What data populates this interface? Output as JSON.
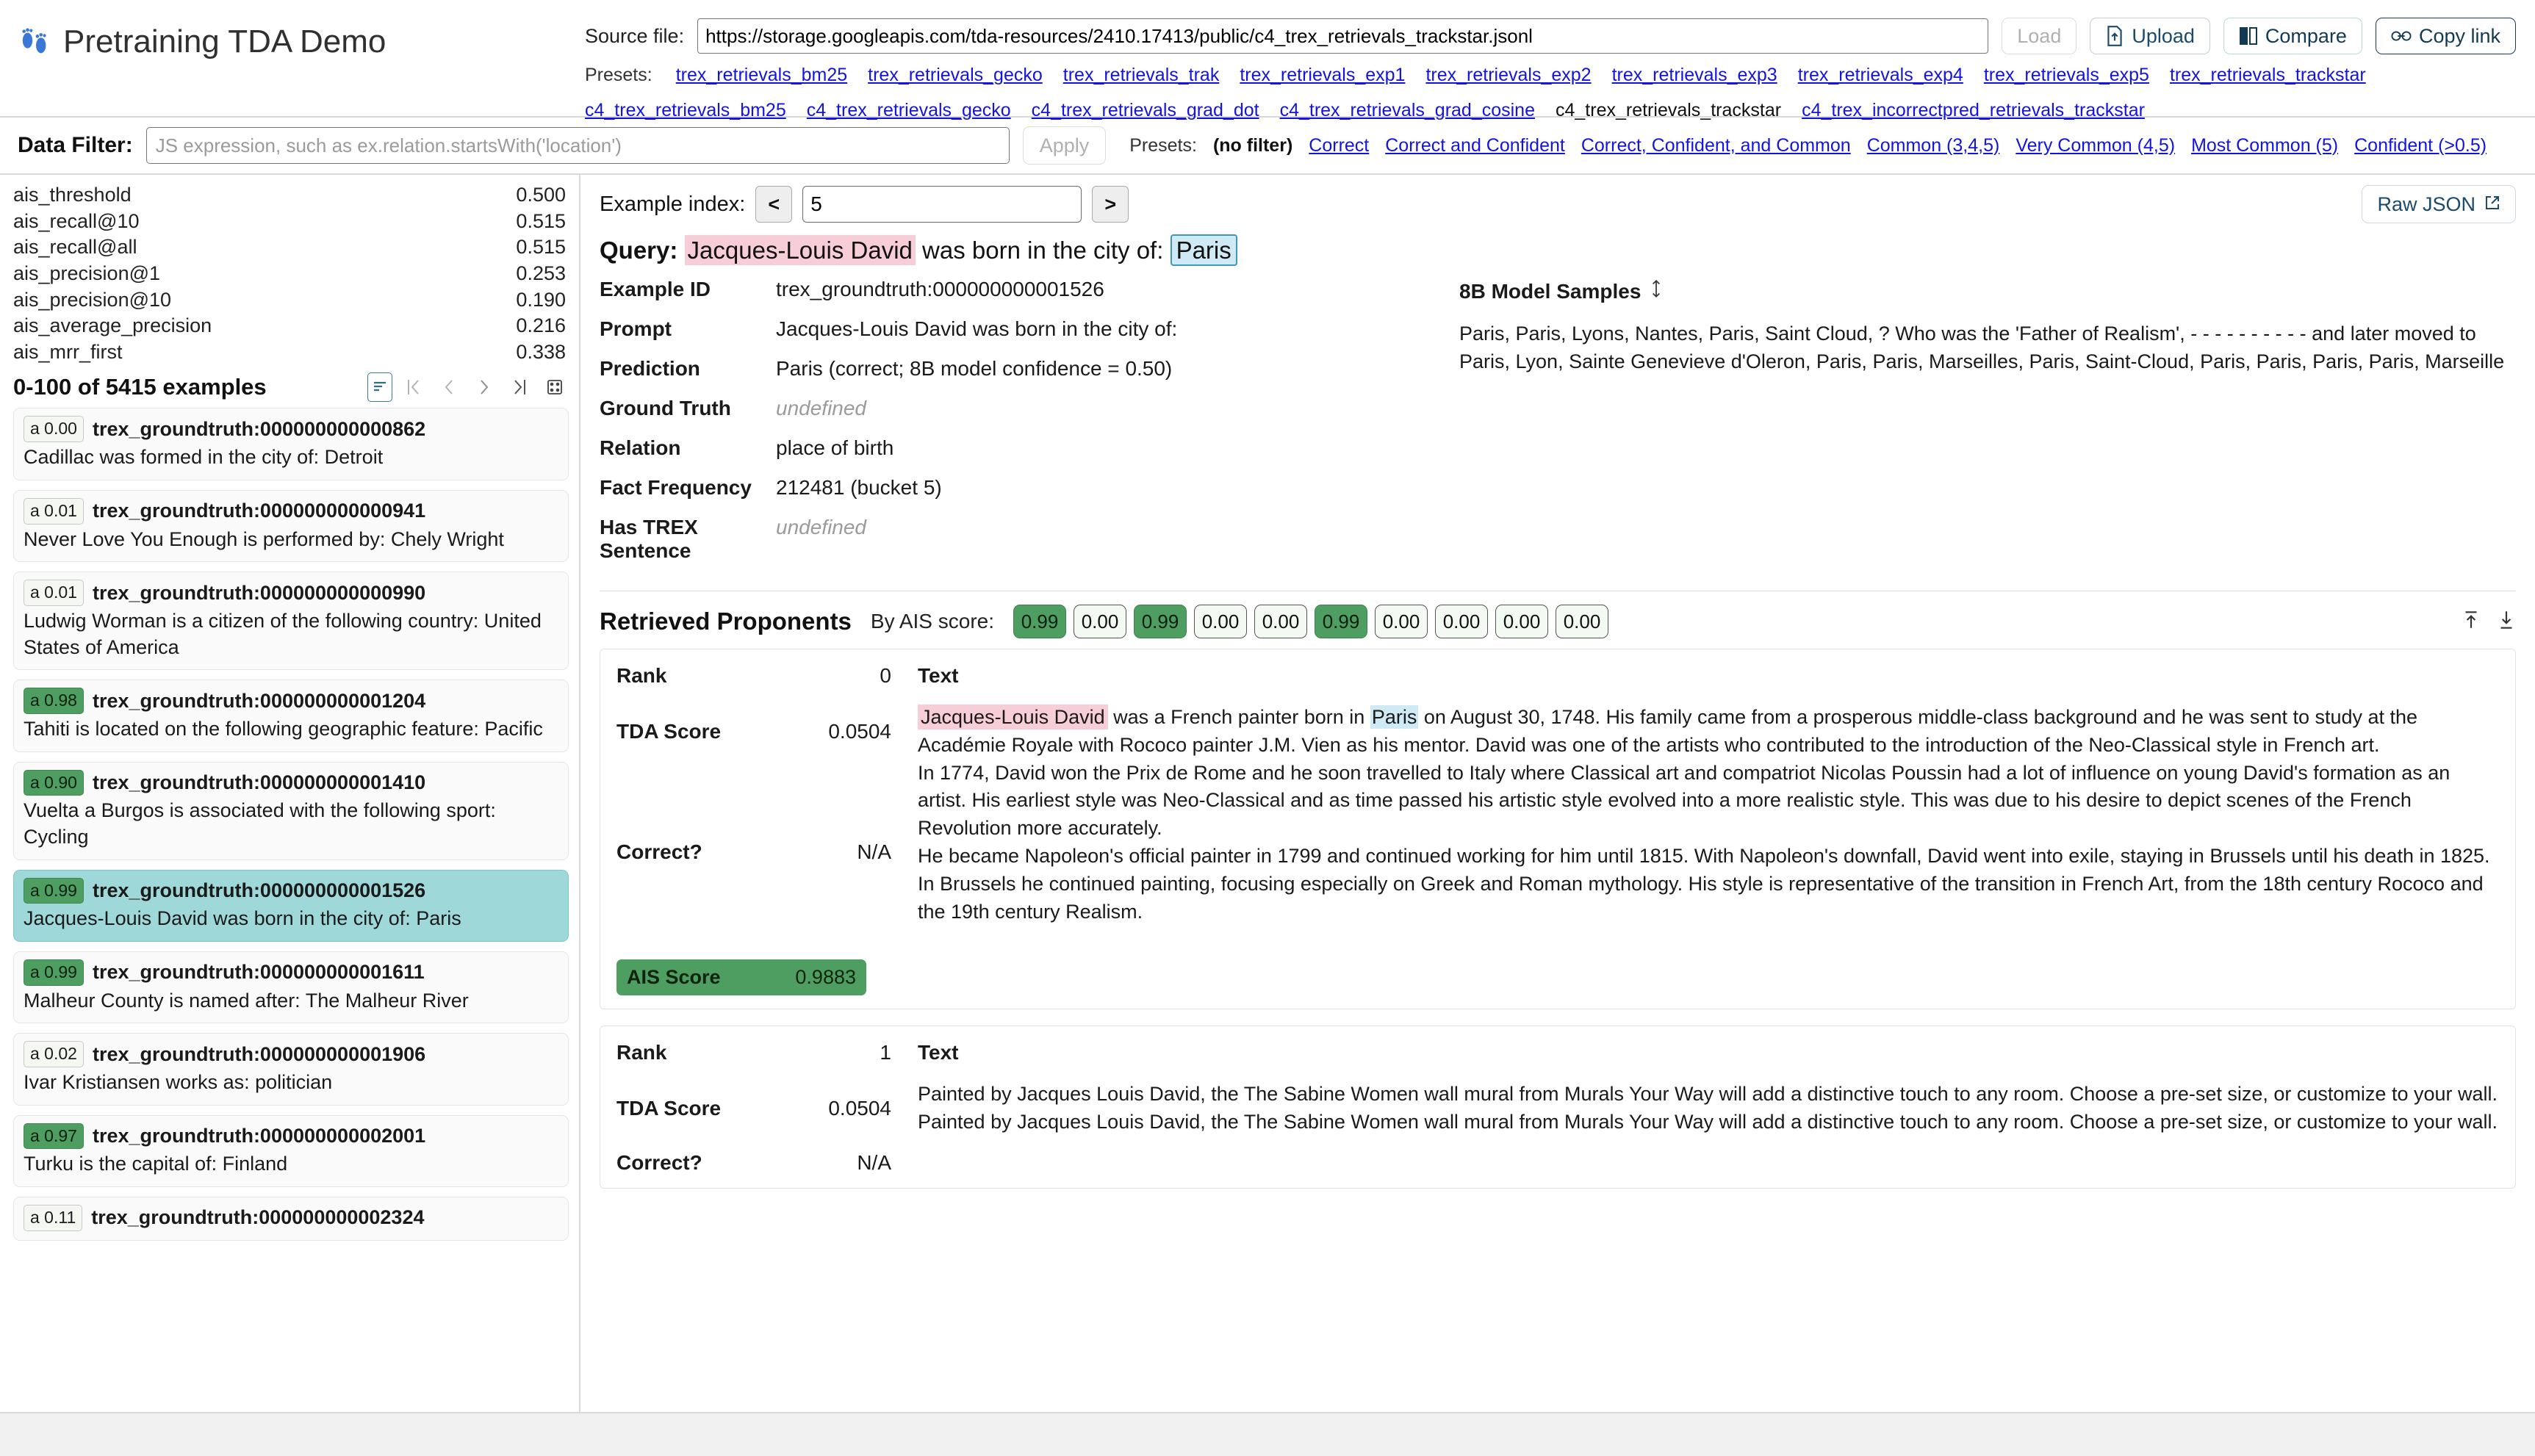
{
  "app": {
    "title": "Pretraining TDA Demo",
    "title_icon": "footprints-icon"
  },
  "source": {
    "label": "Source file:",
    "value": "https://storage.googleapis.com/tda-resources/2410.17413/public/c4_trex_retrievals_trackstar.jsonl",
    "buttons": {
      "load": "Load",
      "upload": "Upload",
      "compare": "Compare",
      "copy_link": "Copy link"
    },
    "presets_label": "Presets:",
    "presets_row1": [
      "trex_retrievals_bm25",
      "trex_retrievals_gecko",
      "trex_retrievals_trak",
      "trex_retrievals_exp1",
      "trex_retrievals_exp2",
      "trex_retrievals_exp3",
      "trex_retrievals_exp4",
      "trex_retrievals_exp5",
      "trex_retrievals_trackstar"
    ],
    "presets_row2": [
      "c4_trex_retrievals_bm25",
      "c4_trex_retrievals_gecko",
      "c4_trex_retrievals_grad_dot",
      "c4_trex_retrievals_grad_cosine",
      "c4_trex_retrievals_trackstar",
      "c4_trex_incorrectpred_retrievals_trackstar"
    ],
    "active_preset": "c4_trex_retrievals_trackstar"
  },
  "filter": {
    "label": "Data Filter:",
    "placeholder": "JS expression, such as ex.relation.startsWith('location')",
    "value": "",
    "apply_label": "Apply",
    "presets_label": "Presets:",
    "no_filter": "(no filter)",
    "presets": [
      "Correct",
      "Correct and Confident",
      "Correct, Confident, and Common",
      "Common (3,4,5)",
      "Very Common (4,5)",
      "Most Common (5)",
      "Confident (>0.5)"
    ]
  },
  "metrics": [
    {
      "name": "ais_threshold",
      "value": "0.500"
    },
    {
      "name": "ais_recall@10",
      "value": "0.515"
    },
    {
      "name": "ais_recall@all",
      "value": "0.515"
    },
    {
      "name": "ais_precision@1",
      "value": "0.253"
    },
    {
      "name": "ais_precision@10",
      "value": "0.190"
    },
    {
      "name": "ais_average_precision",
      "value": "0.216"
    },
    {
      "name": "ais_mrr_first",
      "value": "0.338"
    }
  ],
  "example_list": {
    "count_label": "0-100 of 5415 examples",
    "items": [
      {
        "score": "a 0.00",
        "high": false,
        "id": "trex_groundtruth:000000000000862",
        "text": "Cadillac was formed in the city of: Detroit",
        "selected": false
      },
      {
        "score": "a 0.01",
        "high": false,
        "id": "trex_groundtruth:000000000000941",
        "text": "Never Love You Enough is performed by: Chely Wright",
        "selected": false
      },
      {
        "score": "a 0.01",
        "high": false,
        "id": "trex_groundtruth:000000000000990",
        "text": "Ludwig Worman is a citizen of the following country: United States of America",
        "selected": false
      },
      {
        "score": "a 0.98",
        "high": true,
        "id": "trex_groundtruth:000000000001204",
        "text": "Tahiti is located on the following geographic feature: Pacific",
        "selected": false
      },
      {
        "score": "a 0.90",
        "high": true,
        "id": "trex_groundtruth:000000000001410",
        "text": "Vuelta a Burgos is associated with the following sport: Cycling",
        "selected": false
      },
      {
        "score": "a 0.99",
        "high": true,
        "id": "trex_groundtruth:000000000001526",
        "text": "Jacques-Louis David was born in the city of: Paris",
        "selected": true
      },
      {
        "score": "a 0.99",
        "high": true,
        "id": "trex_groundtruth:000000000001611",
        "text": "Malheur County is named after: The Malheur River",
        "selected": false
      },
      {
        "score": "a 0.02",
        "high": false,
        "id": "trex_groundtruth:000000000001906",
        "text": "Ivar Kristiansen works as: politician",
        "selected": false
      },
      {
        "score": "a 0.97",
        "high": true,
        "id": "trex_groundtruth:000000000002001",
        "text": "Turku is the capital of: Finland",
        "selected": false
      },
      {
        "score": "a 0.11",
        "high": false,
        "id": "trex_groundtruth:000000000002324",
        "text": "",
        "selected": false
      }
    ]
  },
  "main": {
    "index_label": "Example index:",
    "index_value": "5",
    "prev_label": "<",
    "next_label": ">",
    "raw_json_label": "Raw JSON",
    "query": {
      "label": "Query:",
      "subject": "Jacques-Louis David",
      "middle": " was born in the city of: ",
      "object": "Paris"
    },
    "details": [
      {
        "key": "Example ID",
        "value": "trex_groundtruth:000000000001526",
        "undefined": false
      },
      {
        "key": "Prompt",
        "value": "Jacques-Louis David was born in the city of:",
        "undefined": false
      },
      {
        "key": "Prediction",
        "value": "Paris (correct;  8B model confidence = 0.50)",
        "undefined": false
      },
      {
        "key": "Ground Truth",
        "value": "undefined",
        "undefined": true
      },
      {
        "key": "Relation",
        "value": "place of birth",
        "undefined": false
      },
      {
        "key": "Fact Frequency",
        "value": "212481 (bucket 5)",
        "undefined": false
      },
      {
        "key": "Has TREX Sentence",
        "value": "undefined",
        "undefined": true
      }
    ],
    "samples": {
      "title": "8B Model Samples",
      "sort_icon": "sort-updown-icon",
      "text": "Paris, Paris, Lyons, Nantes, Paris, Saint Cloud, ? Who was the 'Father of Realism', - - - - - - - - - - and later moved to Paris, Lyon, Sainte Genevieve d'Oleron, Paris, Paris, Marseilles, Paris, Saint-Cloud, Paris, Paris, Paris, Paris, Marseille"
    },
    "proponents": {
      "title": "Retrieved Proponents",
      "by_ais_label": "By AIS score:",
      "ais_scores": [
        {
          "value": "0.99",
          "high": true
        },
        {
          "value": "0.00",
          "high": false
        },
        {
          "value": "0.99",
          "high": true
        },
        {
          "value": "0.00",
          "high": false
        },
        {
          "value": "0.00",
          "high": false
        },
        {
          "value": "0.99",
          "high": true
        },
        {
          "value": "0.00",
          "high": false
        },
        {
          "value": "0.00",
          "high": false
        },
        {
          "value": "0.00",
          "high": false
        },
        {
          "value": "0.00",
          "high": false
        }
      ],
      "collapse_icon": "collapse-up-icon",
      "expand_icon": "expand-down-icon",
      "cards": [
        {
          "rank_key": "Rank",
          "rank_value": "0",
          "tda_key": "TDA Score",
          "tda_value": "0.0504",
          "correct_key": "Correct?",
          "correct_value": "N/A",
          "ais_key": "AIS Score",
          "ais_value": "0.9883",
          "text_label": "Text",
          "highlight_subject": "Jacques-Louis David",
          "para1_a": " was a French painter born in ",
          "highlight_object": "Paris",
          "para1_b": " on August 30, 1748. His family came from a prosperous middle-class background and he was sent to study at the Académie Royale with Rococo painter J.M. Vien as his mentor. David was one of the artists who contributed to the introduction of the Neo-Classical style in French art.",
          "para2": "In 1774, David won the Prix de Rome and he soon travelled to Italy where Classical art and compatriot Nicolas Poussin had a lot of influence on young David's formation as an artist. His earliest style was Neo-Classical and as time passed his artistic style evolved into a more realistic style. This was due to his desire to depict scenes of the French Revolution more accurately.",
          "para3": "He became Napoleon's official painter in 1799 and continued working for him until 1815. With Napoleon's downfall, David went into exile, staying in Brussels until his death in 1825. In Brussels he continued painting, focusing especially on Greek and Roman mythology. His style is representative of the transition in French Art, from the 18th century Rococo and the 19th century Realism."
        },
        {
          "rank_key": "Rank",
          "rank_value": "1",
          "tda_key": "TDA Score",
          "tda_value": "0.0504",
          "correct_key": "Correct?",
          "correct_value": "N/A",
          "text_label": "Text",
          "para1": "Painted by Jacques Louis David, the The Sabine Women wall mural from Murals Your Way will add a distinctive touch to any room. Choose a pre-set size, or customize to your wall.",
          "para2": "Painted by Jacques Louis David, the The Sabine Women wall mural from Murals Your Way will add a distinctive touch to any room. Choose a pre-set size, or customize to your wall."
        }
      ]
    }
  }
}
